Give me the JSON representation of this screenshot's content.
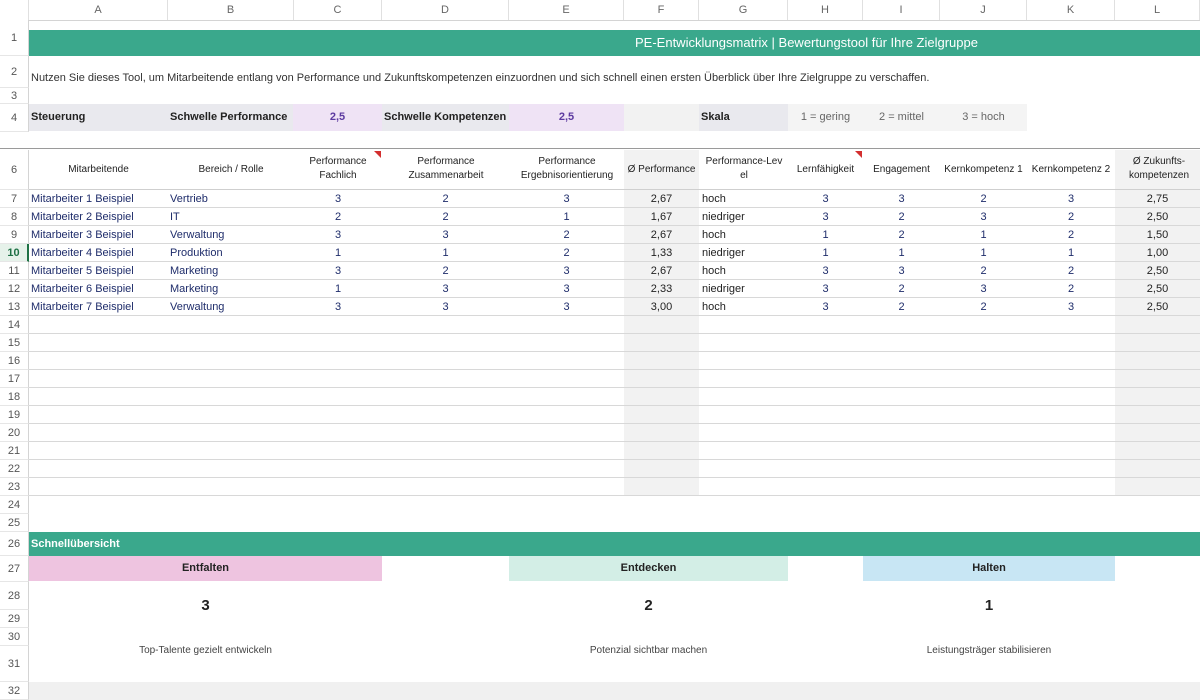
{
  "columns": [
    "A",
    "B",
    "C",
    "D",
    "E",
    "F",
    "G",
    "H",
    "I",
    "J",
    "K",
    "L"
  ],
  "row_numbers": [
    "1",
    "2",
    "3",
    "4",
    "6",
    "7",
    "8",
    "9",
    "10",
    "11",
    "12",
    "13",
    "14",
    "15",
    "16",
    "17",
    "18",
    "19",
    "20",
    "21",
    "22",
    "23",
    "24",
    "25",
    "26",
    "27",
    "28",
    "29",
    "30",
    "31",
    "32"
  ],
  "selected_row": "10",
  "title": "PE-Entwicklungsmatrix | Bewertungstool für Ihre Zielgruppe",
  "intro": "Nutzen Sie dieses Tool, um Mitarbeitende entlang von Performance und Zukunftskompetenzen einzuordnen und sich schnell einen ersten Überblick über Ihre Zielgruppe zu verschaffen.",
  "control": {
    "label": "Steuerung",
    "perf_threshold_label": "Schwelle  Performance",
    "perf_threshold_value": "2,5",
    "comp_threshold_label": "Schwelle Kompetenzen",
    "comp_threshold_value": "2,5",
    "scale_label": "Skala",
    "scale_low": "1 = gering",
    "scale_mid": "2 = mittel",
    "scale_high": "3 = hoch"
  },
  "table": {
    "headers": [
      "Mitarbeitende",
      "Bereich / Rolle",
      "Performance Fachlich",
      "Performance Zusammenarbeit",
      "Performance Ergebnisorientierung",
      "Ø Performance",
      "Performance-Lev el",
      "Lernfähigkeit",
      "Engagement",
      "Kernkompetenz 1",
      "Kernkompetenz 2",
      "Ø Zukunfts-kompetenzen"
    ],
    "rows": [
      [
        "Mitarbeiter 1 Beispiel",
        "Vertrieb",
        "3",
        "2",
        "3",
        "2,67",
        "hoch",
        "3",
        "3",
        "2",
        "3",
        "2,75"
      ],
      [
        "Mitarbeiter 2 Beispiel",
        "IT",
        "2",
        "2",
        "1",
        "1,67",
        "niedriger",
        "3",
        "2",
        "3",
        "2",
        "2,50"
      ],
      [
        "Mitarbeiter 3 Beispiel",
        "Verwaltung",
        "3",
        "3",
        "2",
        "2,67",
        "hoch",
        "1",
        "2",
        "1",
        "2",
        "1,50"
      ],
      [
        "Mitarbeiter 4 Beispiel",
        "Produktion",
        "1",
        "1",
        "2",
        "1,33",
        "niedriger",
        "1",
        "1",
        "1",
        "1",
        "1,00"
      ],
      [
        "Mitarbeiter 5 Beispiel",
        "Marketing",
        "3",
        "2",
        "3",
        "2,67",
        "hoch",
        "3",
        "3",
        "2",
        "2",
        "2,50"
      ],
      [
        "Mitarbeiter 6 Beispiel",
        "Marketing",
        "1",
        "3",
        "3",
        "2,33",
        "niedriger",
        "3",
        "2",
        "3",
        "2",
        "2,50"
      ],
      [
        "Mitarbeiter 7 Beispiel",
        "Verwaltung",
        "3",
        "3",
        "3",
        "3,00",
        "hoch",
        "3",
        "2",
        "2",
        "3",
        "2,50"
      ]
    ]
  },
  "overview": {
    "title": "Schnellübersicht",
    "cards": [
      {
        "label": "Entfalten",
        "count": "3",
        "desc": "Top-Talente gezielt entwickeln",
        "color": "#eec4e0"
      },
      {
        "label": "Entdecken",
        "count": "2",
        "desc": "Potenzial sichtbar machen",
        "color": "#d3eee6"
      },
      {
        "label": "Halten",
        "count": "1",
        "desc": "Leistungsträger stabilisieren",
        "color": "#c8e6f4"
      }
    ]
  },
  "colors": {
    "banner": "#3aa88c",
    "threshold_bg": "#efe3f5",
    "control_bg": "#e9e9ee",
    "gray_col": "#f2f2f2",
    "accent_purple": "#5c3aa0"
  }
}
